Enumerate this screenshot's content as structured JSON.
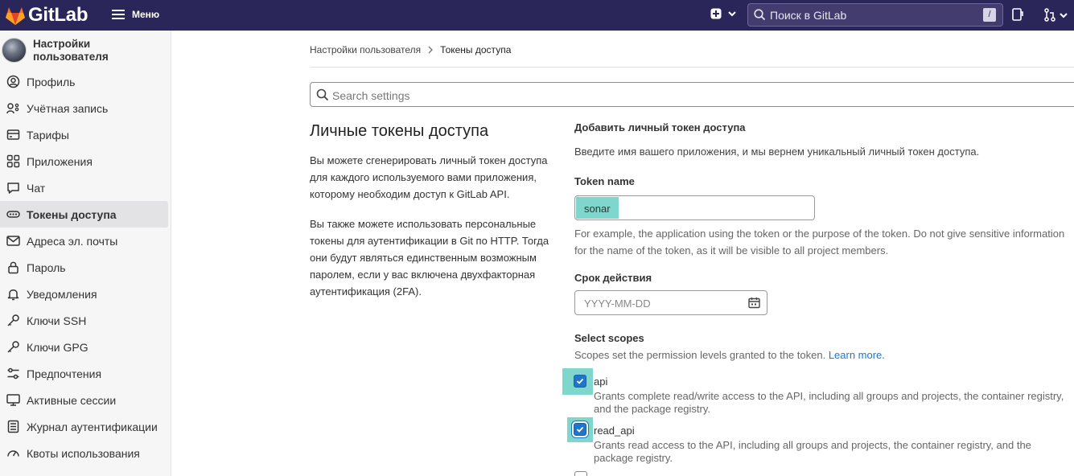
{
  "header": {
    "logo_text": "GitLab",
    "menu_label": "Меню",
    "search_placeholder": "Поиск в GitLab",
    "search_shortcut": "/"
  },
  "sidebar": {
    "title": "Настройки пользователя",
    "items": [
      {
        "label": "Профиль",
        "icon": "profile-icon",
        "active": false
      },
      {
        "label": "Учётная запись",
        "icon": "account-icon",
        "active": false
      },
      {
        "label": "Тарифы",
        "icon": "billing-icon",
        "active": false
      },
      {
        "label": "Приложения",
        "icon": "applications-icon",
        "active": false
      },
      {
        "label": "Чат",
        "icon": "chat-icon",
        "active": false
      },
      {
        "label": "Токены доступа",
        "icon": "token-icon",
        "active": true
      },
      {
        "label": "Адреса эл. почты",
        "icon": "mail-icon",
        "active": false
      },
      {
        "label": "Пароль",
        "icon": "lock-icon",
        "active": false
      },
      {
        "label": "Уведомления",
        "icon": "bell-icon",
        "active": false
      },
      {
        "label": "Ключи SSH",
        "icon": "key-icon",
        "active": false
      },
      {
        "label": "Ключи GPG",
        "icon": "key-icon",
        "active": false
      },
      {
        "label": "Предпочтения",
        "icon": "preferences-icon",
        "active": false
      },
      {
        "label": "Активные сессии",
        "icon": "monitor-icon",
        "active": false
      },
      {
        "label": "Журнал аутентификации",
        "icon": "log-icon",
        "active": false
      },
      {
        "label": "Квоты использования",
        "icon": "quota-icon",
        "active": false
      }
    ]
  },
  "breadcrumb": {
    "parent": "Настройки пользователя",
    "current": "Токены доступа"
  },
  "settings_search_placeholder": "Search settings",
  "intro": {
    "title": "Личные токены доступа",
    "paragraph_1": "Вы можете сгенерировать личный токен доступа для каждого используемого вами приложения, которому необходим доступ к GitLab API.",
    "paragraph_2": "Вы также можете использовать персональные токены для аутентификации в Git по HTTP. Тогда они будут являться единственным возможным паролем, если у вас включена двухфакторная аутентификация (2FA)."
  },
  "form": {
    "title": "Добавить личный токен доступа",
    "description": "Введите имя вашего приложения, и мы вернем уникальный личный токен доступа.",
    "token_name_label": "Token name",
    "token_name_value": "sonar",
    "token_name_help": "For example, the application using the token or the purpose of the token. Do not give sensitive information for the name of the token, as it will be visible to all project members.",
    "expiry_label": "Срок действия",
    "expiry_placeholder": "YYYY-MM-DD",
    "scopes_label": "Select scopes",
    "scopes_help": "Scopes set the permission levels granted to the token.",
    "learn_more": "Learn more.",
    "scopes": [
      {
        "name": "api",
        "checked": true,
        "description": "Grants complete read/write access to the API, including all groups and projects, the container registry, and the package registry."
      },
      {
        "name": "read_api",
        "checked": true,
        "description": "Grants read access to the API, including all groups and projects, the container registry, and the package registry."
      },
      {
        "name": "",
        "checked": false,
        "description": ""
      }
    ]
  },
  "colors": {
    "header_bg": "#2b2659",
    "sidebar_bg": "#f6f6f6",
    "highlight": "#7fd6cd",
    "link": "#1f75cb",
    "checkbox": "#1f75cb"
  }
}
